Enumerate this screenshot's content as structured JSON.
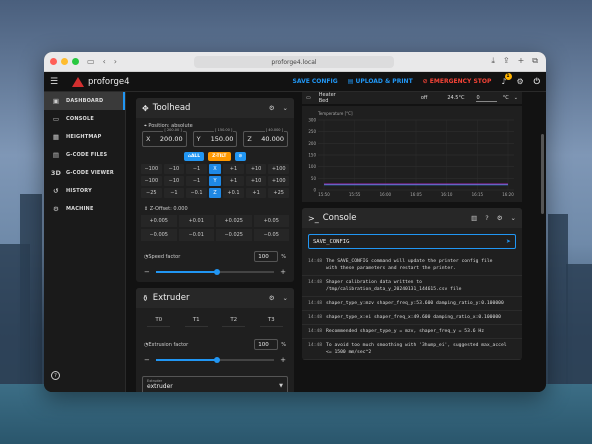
{
  "browser": {
    "url": "proforge4.local"
  },
  "app": {
    "brand": "proforge4",
    "actions": {
      "save_config": "SAVE CONFIG",
      "upload_print": "UPLOAD & PRINT",
      "emergency_stop": "EMERGENCY STOP"
    },
    "notification_count": "1"
  },
  "sidebar": {
    "items": [
      {
        "label": "DASHBOARD",
        "icon": "dashboard-icon"
      },
      {
        "label": "CONSOLE",
        "icon": "console-icon"
      },
      {
        "label": "HEIGHTMAP",
        "icon": "heightmap-icon"
      },
      {
        "label": "G-CODE FILES",
        "icon": "files-icon"
      },
      {
        "label": "G-CODE VIEWER",
        "icon": "3d-icon"
      },
      {
        "label": "HISTORY",
        "icon": "history-icon"
      },
      {
        "label": "MACHINE",
        "icon": "gear-icon"
      }
    ]
  },
  "toolhead": {
    "title": "Toolhead",
    "position_label": "Position: absolute",
    "axes": [
      {
        "label": "X",
        "max": "[ 200.00 ]",
        "value": "200.00"
      },
      {
        "label": "Y",
        "max": "[ 150.00 ]",
        "value": "150.00"
      },
      {
        "label": "Z",
        "max": "[ 40.000 ]",
        "value": "40.000"
      }
    ],
    "home_all": "ALL",
    "z_tilt": "Z-TILT",
    "jog_rows": [
      [
        "−100",
        "−10",
        "−1",
        "X",
        "+1",
        "+10",
        "+100"
      ],
      [
        "−100",
        "−10",
        "−1",
        "Y",
        "+1",
        "+10",
        "+100"
      ],
      [
        "−25",
        "−1",
        "−0.1",
        "Z",
        "+0.1",
        "+1",
        "+25"
      ]
    ],
    "z_offset_label": "Z-Offset: 0.000",
    "z_offset_rows": [
      [
        "+0.005",
        "+0.01",
        "+0.025",
        "+0.05"
      ],
      [
        "−0.005",
        "−0.01",
        "−0.025",
        "−0.05"
      ]
    ],
    "speed_factor_label": "Speed factor",
    "speed_factor_value": "100",
    "speed_factor_unit": "%",
    "speed_factor_level": 0.52
  },
  "extruder": {
    "title": "Extruder",
    "tools": [
      "T0",
      "T1",
      "T2",
      "T3"
    ],
    "extrusion_factor_label": "Extrusion factor",
    "extrusion_factor_value": "100",
    "extrusion_factor_unit": "%",
    "extrusion_factor_level": 0.52,
    "select_label": "Extruder",
    "select_value": "extruder"
  },
  "heater": {
    "name": "Heater Bed",
    "state": "off",
    "temp": "24.5°C",
    "target": "0",
    "unit": "°C"
  },
  "chart_data": {
    "type": "line",
    "title": "",
    "ylabel": "Temperature [°C]",
    "ylim": [
      0,
      300
    ],
    "yticks": [
      "300",
      "250",
      "200",
      "150",
      "100",
      "50",
      "0"
    ],
    "xticks": [
      "15:50",
      "15:55",
      "16:00",
      "16:05",
      "16:10",
      "16:15",
      "16:20"
    ],
    "series": [
      {
        "color": "#f44336",
        "values": [
          24,
          24,
          24,
          24,
          24,
          24,
          24
        ]
      },
      {
        "color": "#2196f3",
        "values": [
          22,
          22,
          22,
          22,
          22,
          22,
          22
        ]
      },
      {
        "color": "#9c27b0",
        "values": [
          26,
          26,
          26,
          26,
          26,
          26,
          26
        ]
      }
    ]
  },
  "console": {
    "title": "Console",
    "input_value": "SAVE_CONFIG",
    "entries": [
      {
        "time": "14:48",
        "msg": "The SAVE_CONFIG command will update the printer config file\nwith these parameters and restart the printer."
      },
      {
        "time": "14:48",
        "msg": "Shaper calibration data written to\n/tmp/calibration_data_y_20240131_144615.csv file"
      },
      {
        "time": "14:48",
        "msg": "shaper_type_y:mzv shaper_freq_y:53.600 damping_ratio_y:0.100000"
      },
      {
        "time": "14:48",
        "msg": "shaper_type_x:ei shaper_freq_x:49.600 damping_ratio_x:0.100000"
      },
      {
        "time": "14:48",
        "msg": "Recommended shaper_type_y = mzv, shaper_freq_y = 53.6 Hz"
      },
      {
        "time": "14:48",
        "msg": "To avoid too much smoothing with '3hump_ei', suggested max_accel\n<= 1500 mm/sec^2"
      }
    ]
  }
}
